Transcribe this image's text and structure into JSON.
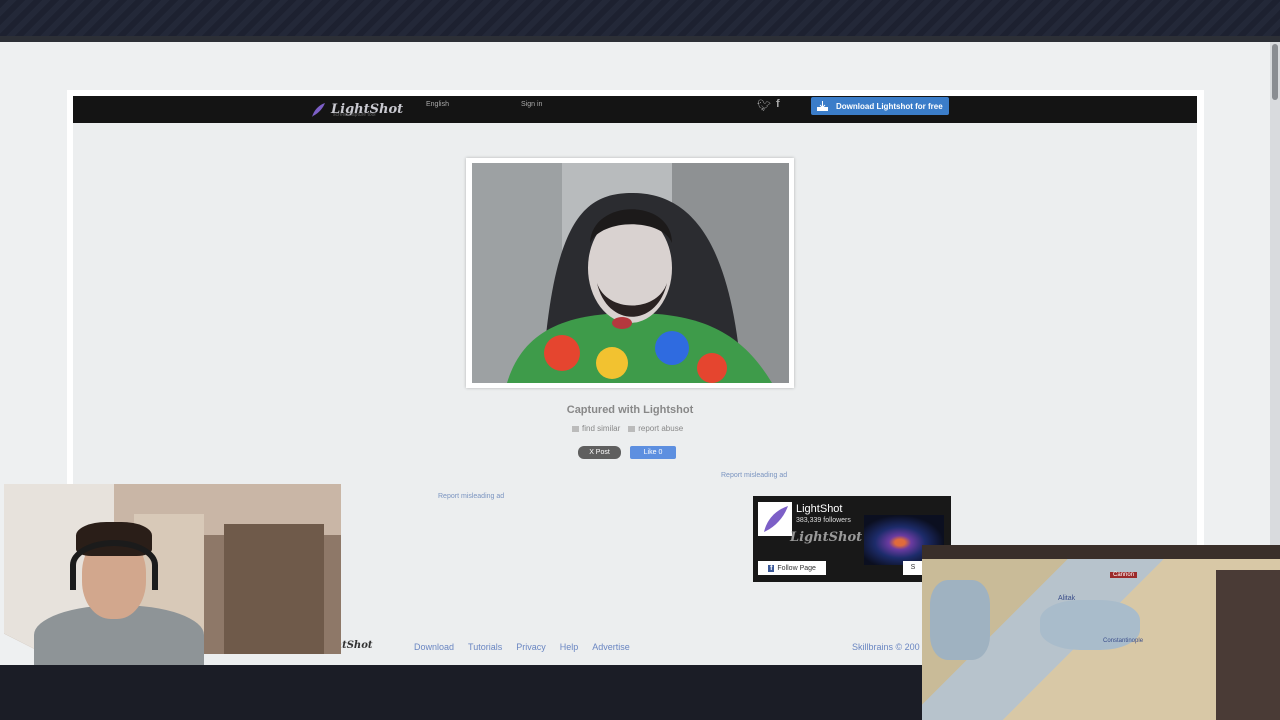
{
  "header": {
    "logo_text": "LightShot",
    "logo_subtitle": "screen capture tool",
    "language": "English",
    "signin": "Sign in",
    "download_button": "Download Lightshot for free",
    "twitter_icon": "twitter-icon",
    "facebook_icon": "facebook-icon"
  },
  "main": {
    "caption": "Captured with Lightshot",
    "find_similar": "find similar",
    "report_abuse": "report abuse",
    "post_button": "X Post",
    "like_button": "Like 0",
    "report_misleading_ad_1": "Report misleading ad",
    "report_misleading_ad_2": "Report misleading ad"
  },
  "fb_widget": {
    "page_name": "LightShot",
    "followers": "383,339 followers",
    "logo_text": "LightShot",
    "follow_button": "Follow Page",
    "share_button": "S"
  },
  "footer": {
    "logo_text": "LightShot",
    "links": [
      "Download",
      "Tutorials",
      "Privacy",
      "Help",
      "Advertise"
    ],
    "copyright": "Skillbrains © 200"
  },
  "game_overlay": {
    "label_1": "Alitak",
    "label_2": "Constantinople",
    "label_3": "Cannon"
  },
  "colors": {
    "accent_blue": "#3b7dc9",
    "link_blue": "#6a86c2",
    "header_black": "#141414"
  }
}
